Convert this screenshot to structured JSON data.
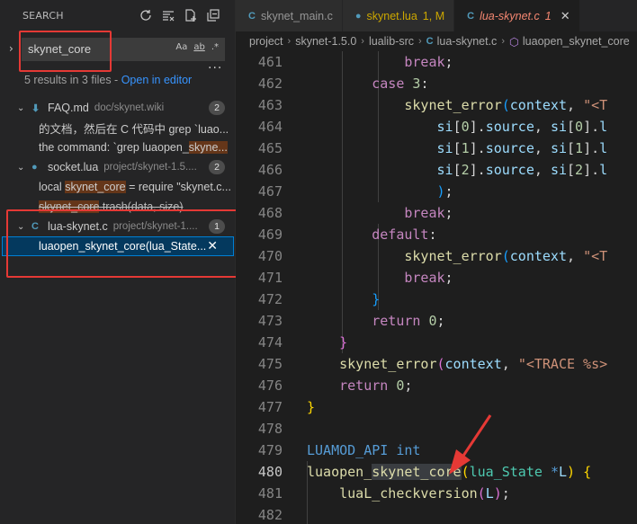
{
  "sidebar": {
    "title": "SEARCH",
    "search": {
      "value": "skynet_core",
      "opt_case": "Aa",
      "opt_word": "ab",
      "opt_regex": ".*"
    },
    "more": "...",
    "results_summary": "5 results in 3 files - ",
    "open_in_editor": "Open in editor",
    "files": [
      {
        "name": "FAQ.md",
        "path": "doc/skynet.wiki",
        "count": "2",
        "icon": "markdown-icon",
        "matches": [
          {
            "pre": "的文档，然后在 C 代码中 grep `luao...",
            "hl": "",
            "post": ""
          },
          {
            "pre": "the command: `grep luaopen_",
            "hl": "skyne...",
            "post": ""
          }
        ]
      },
      {
        "name": "socket.lua",
        "path": "project/skynet-1.5....",
        "count": "2",
        "icon": "lua-icon",
        "matches": [
          {
            "pre": "local ",
            "hl": "skynet_core",
            "post": " = require \"skynet.c..."
          },
          {
            "pre": "",
            "hl": "skynet_core",
            "post": ".trash(data, size)"
          }
        ]
      },
      {
        "name": "lua-skynet.c",
        "path": "project/skynet-1....",
        "count": "1",
        "icon": "c-file-icon",
        "matches": [
          {
            "pre": "luaopen_",
            "hl": "skynet_core",
            "post": "(lua_State..."
          }
        ]
      }
    ]
  },
  "tabs": [
    {
      "label": "skynet_main.c",
      "icon": "C",
      "color": "#519aba",
      "badge": "",
      "active": false
    },
    {
      "label": "skynet.lua",
      "icon": "lua",
      "color": "#cca700",
      "badge": "1, M",
      "active": false
    },
    {
      "label": "lua-skynet.c",
      "icon": "C",
      "color": "#519aba",
      "badge": "1",
      "active": true
    }
  ],
  "breadcrumb": [
    "project",
    "skynet-1.5.0",
    "lualib-src",
    "lua-skynet.c",
    "luaopen_skynet_core"
  ],
  "editor": {
    "current_line": "480",
    "lines": [
      "461",
      "462",
      "463",
      "464",
      "465",
      "466",
      "467",
      "468",
      "469",
      "470",
      "471",
      "472",
      "473",
      "474",
      "475",
      "476",
      "477",
      "478",
      "479",
      "480",
      "481",
      "482"
    ]
  },
  "colors": {
    "accent": "#007fd4",
    "match_highlight": "#ea5c00",
    "annotation_red": "#e53935"
  }
}
